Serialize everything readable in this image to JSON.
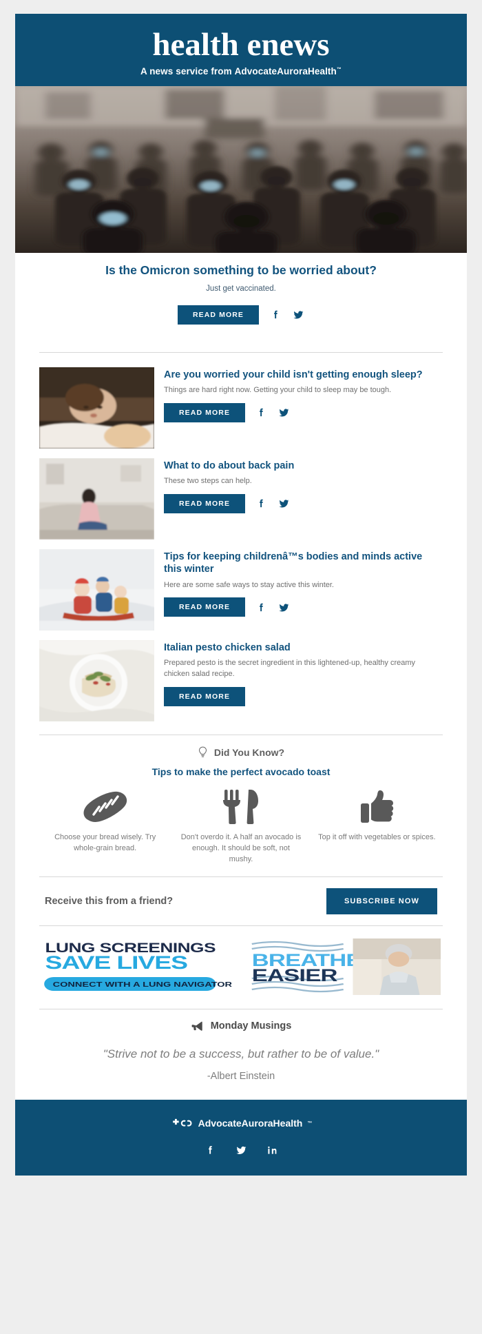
{
  "header": {
    "title": "health enews",
    "subtitle_prefix": "A news service from ",
    "brand": "AdvocateAuroraHealth",
    "trademark": "™"
  },
  "hero": {
    "image_alt": "crowd-of-masked-pedestrians",
    "title": "Is the Omicron something to be worried about?",
    "description": "Just get vaccinated.",
    "read_more": "READ MORE",
    "facebook_icon": "facebook-icon",
    "twitter_icon": "twitter-icon"
  },
  "articles": [
    {
      "image_alt": "child-lying-on-bed",
      "title": "Are you worried your child isn't getting enough sleep?",
      "description": "Things are hard right now. Getting your child to sleep may be tough.",
      "read_more": "READ MORE",
      "has_social": true
    },
    {
      "image_alt": "woman-sitting-on-couch-with-back-pain",
      "title": "What to do about back pain",
      "description": "These two steps can help.",
      "read_more": "READ MORE",
      "has_social": true
    },
    {
      "image_alt": "children-playing-in-snow",
      "title": "Tips for keeping childrenâ™s bodies and minds active this winter",
      "description": "Here are some safe ways to stay active this winter.",
      "read_more": "READ MORE",
      "has_social": true
    },
    {
      "image_alt": "plate-of-chicken-salad-sandwich",
      "title": "Italian pesto chicken salad",
      "description": "Prepared pesto is the secret ingredient in this lightened-up, healthy creamy chicken salad recipe.",
      "read_more": "READ MORE",
      "has_social": false
    }
  ],
  "did_you_know": {
    "icon": "lightbulb-icon",
    "label": "Did You Know?",
    "subtitle": "Tips to make the perfect avocado toast",
    "tips": [
      {
        "icon": "bread-loaf-icon",
        "text": "Choose your bread wisely. Try whole-grain bread."
      },
      {
        "icon": "fork-and-knife-icon",
        "text": "Don't overdo it. A half an avocado is enough. It should be soft, not mushy."
      },
      {
        "icon": "thumbs-up-icon",
        "text": "Top it off with vegetables or spices."
      }
    ]
  },
  "subscribe": {
    "prompt": "Receive this from a friend?",
    "button": "SUBSCRIBE NOW"
  },
  "ads": [
    {
      "name": "lung-screenings-ad",
      "line1": "LUNG SCREENINGS",
      "line2": "SAVE LIVES",
      "line3": "CONNECT WITH A LUNG NAVIGATOR"
    },
    {
      "name": "breathe-easier-ad",
      "line1": "BREATHE",
      "line2": "EASIER",
      "image_alt": "senior-woman-in-kitchen"
    }
  ],
  "musings": {
    "icon": "megaphone-icon",
    "label": "Monday Musings",
    "quote": "\"Strive not to be a success, but rather to be of value.\"",
    "attribution": "-Albert Einstein"
  },
  "footer": {
    "logo_mark": "advocate-aurora-logo-mark",
    "brand": "AdvocateAuroraHealth",
    "trademark": "™",
    "social": [
      {
        "icon": "facebook-icon",
        "name": "facebook"
      },
      {
        "icon": "twitter-icon",
        "name": "twitter"
      },
      {
        "icon": "linkedin-icon",
        "name": "linkedin"
      }
    ]
  },
  "colors": {
    "brand_dark": "#0d4f74",
    "button": "#0d527a",
    "link_blue": "#12537e",
    "body_text": "#6f6f6f",
    "page_bg": "#eeeeee"
  }
}
